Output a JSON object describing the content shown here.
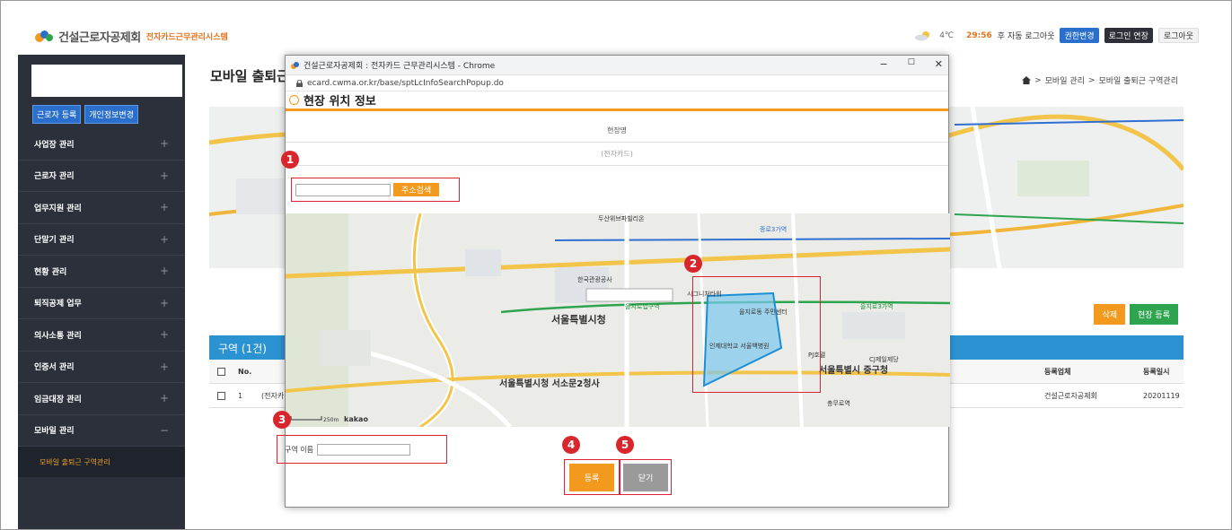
{
  "header": {
    "org_name": "건설근로자공제회",
    "system_name": "전자카드근무관리시스템",
    "weather_temp": "4℃",
    "session_timer": "29:56",
    "auto_logout_text": "후 자동 로그아웃",
    "btn_permission": "권한변경",
    "btn_extend": "로그인 연장",
    "btn_logout": "로그아웃",
    "weather_icon": "cloud-sun-icon"
  },
  "sidebar": {
    "btn_register_worker": "근로자 등록",
    "btn_change_personal": "개인정보변경",
    "items": [
      {
        "label": "사업장 관리"
      },
      {
        "label": "근로자 관리"
      },
      {
        "label": "업무지원 관리"
      },
      {
        "label": "단말기 관리"
      },
      {
        "label": "현황 관리"
      },
      {
        "label": "퇴직공제 업무"
      },
      {
        "label": "의사소통 관리"
      },
      {
        "label": "인증서 관리"
      },
      {
        "label": "임금대장 관리"
      },
      {
        "label": "모바일 관리"
      }
    ],
    "plus_symbol": "+",
    "minus_symbol": "−",
    "sub_item": "모바일 출퇴근 구역관리"
  },
  "main": {
    "page_title": "모바일 출퇴근 구역관리",
    "breadcrumb": {
      "level1": "모바일 관리",
      "level2": "모바일 출퇴근 구역관리",
      "separator": ">"
    },
    "btn_delete": "삭제",
    "btn_register_site": "현장 등록",
    "zone_header": "구역 (1건)",
    "table": {
      "col_no": "No.",
      "col_registrant": "등록업체",
      "col_date": "등록일시",
      "rows": [
        {
          "no": "1",
          "name": "(전자카",
          "registrant": "건설근로자공제회",
          "date": "20201119"
        }
      ]
    }
  },
  "popup": {
    "window_title": "건설근로자공제회 : 전자카드 근무관리시스템 - Chrome",
    "url": "ecard.cwma.or.kr/base/sptLcInfoSearchPopup.do",
    "heading": "현장 위치 정보",
    "site_name_label": "현장명",
    "site_name_value": "(전자카드)",
    "addr_search_btn": "주소검색",
    "zone_name_label": "구역 이름",
    "btn_register": "등록",
    "btn_close": "닫기",
    "win_minimize": "−",
    "win_maximize": "☐",
    "win_close": "✕",
    "map_labels": [
      "서울특별시청",
      "서울특별시청 서소문2청사",
      "서울특별시 중구청",
      "을지로입구역",
      "을지로3가역",
      "시그니처타워",
      "충무로역",
      "을지로동 주민센터",
      "인제대학교 서울백병원",
      "두산위브파빌리온",
      "한국관광공사",
      "종로3가역",
      "CJ제일제당",
      "PJ호텔",
      "kakao",
      "250m"
    ]
  },
  "markers": {
    "m1": "1",
    "m2": "2",
    "m3": "3",
    "m4": "4",
    "m5": "5"
  },
  "colors": {
    "accent_orange": "#f39a1e",
    "sidebar_bg": "#2b303b",
    "blue": "#2a6fcc",
    "zone_header": "#2c93d3",
    "green": "#2ea44f",
    "marker_red": "#d8262d",
    "polygon_fill": "#7cc8ee"
  }
}
